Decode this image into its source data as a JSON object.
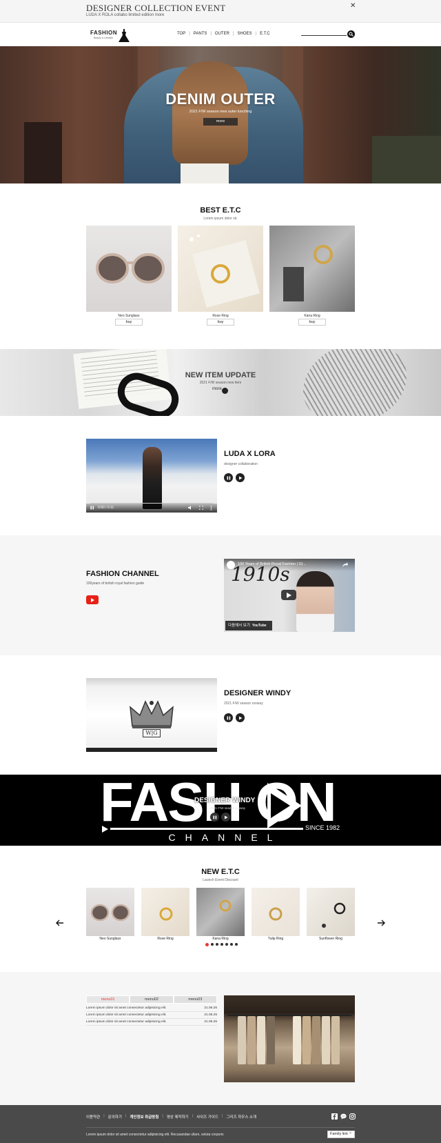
{
  "event_bar": {
    "title": "DESIGNER COLLECTION EVENT",
    "subtitle": "LUDA X ROLA collabo limited edition more",
    "close_label": "✕"
  },
  "header": {
    "logo_text": "FASHION",
    "logo_sub": "Beauty & Lifestyle",
    "nav": [
      "TOP",
      "PANTS",
      "OUTER",
      "SHOES",
      "E.T.C"
    ],
    "search_icon": "search-icon"
  },
  "hero": {
    "title": "DENIM OUTER",
    "subtitle": "2021 F/W season new outer lunching",
    "more_label": "more"
  },
  "best": {
    "title": "BEST E.T.C",
    "subtitle": "Lorem ipsum dolor sit.",
    "items": [
      {
        "name": "Neo Sunglass",
        "buy": "buy"
      },
      {
        "name": "Rose Ring",
        "buy": "buy"
      },
      {
        "name": "Kana Ring",
        "buy": "buy"
      }
    ]
  },
  "new_item": {
    "title": "NEW ITEM UPDATE",
    "subtitle": "2021 F/W season new item",
    "more_label": "more"
  },
  "video1": {
    "title": "LUDA X LORA",
    "subtitle": "designer collaboration",
    "time": "0:00 / 0:11"
  },
  "channel": {
    "title": "FASHION CHANNEL",
    "subtitle": "100years of british royal fashion guide",
    "yt_overlay_title": "100 Years of British Royal Fashion | Gl...",
    "yt_year": "1910s",
    "yt_watch_label": "다음에서 보기",
    "yt_brand": "YouTube"
  },
  "video3": {
    "title": "DESIGNER WINDY",
    "subtitle": "2021 F/W season runway",
    "monogram": "W|G"
  },
  "fashion_banner": {
    "big_text": "FASH ON",
    "since": "SINCE 1982",
    "channel": "CHANNEL",
    "overlay_title": "DESIGNER WINDY",
    "overlay_sub": "2021 F/W season runway"
  },
  "new_etc": {
    "title": "NEW E.T.C",
    "subtitle": "Launch Event Discount",
    "items": [
      {
        "name": "Neo Sunglass"
      },
      {
        "name": "Rose Ring"
      },
      {
        "name": "Kana Ring"
      },
      {
        "name": "Tulip Ring"
      },
      {
        "name": "Sunflower Ring"
      }
    ],
    "dots": 7,
    "active_dot": 0,
    "accent": "#e53935"
  },
  "news": {
    "tabs": [
      "menu01",
      "menu02",
      "menu03"
    ],
    "active_tab": 0,
    "rows": [
      {
        "text": "Lorem ipsum dolor sit amet consectetur adipisicing elit.",
        "date": "21.06.25"
      },
      {
        "text": "Lorem ipsum dolor sit amet consectetur adipisicing elit.",
        "date": "21.06.25"
      },
      {
        "text": "Lorem ipsum dolor sit amet consectetur adipisicing elit.",
        "date": "21.06.25"
      }
    ]
  },
  "footer": {
    "links": [
      "이용약관",
      "문의하기",
      "개인정보 취급방침",
      "영상 제작하기",
      "사이즈 가이드",
      "그리즈 하우스 소개"
    ],
    "bold_link_index": 2,
    "sns": [
      "facebook-icon",
      "chat-icon",
      "instagram-icon"
    ],
    "copy": "Lorem ipsum dolor sit amet consectetur adipisicing elit. Recusandae ullam, soluta corporis",
    "family_link": "Family link"
  },
  "colors": {
    "footer_bg": "#4a4a4a",
    "section_bg": "#f6f6f6",
    "youtube_red": "#e62117"
  }
}
